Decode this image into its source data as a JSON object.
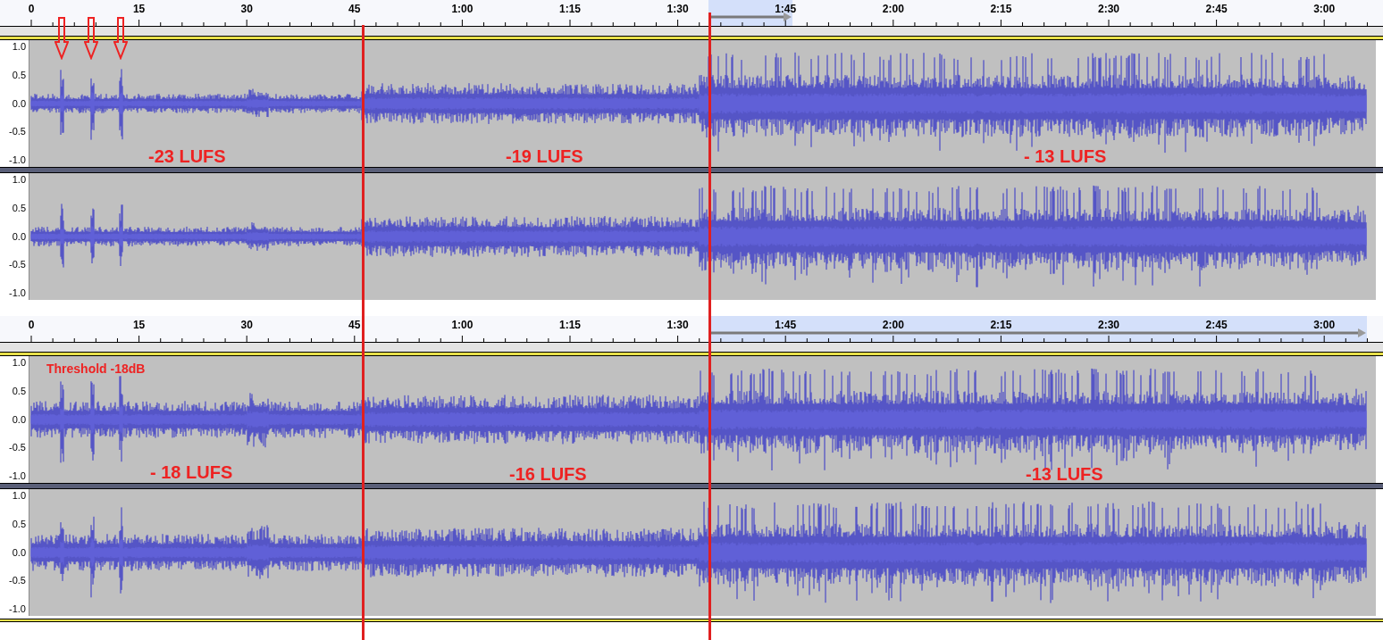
{
  "projects": [
    {
      "ruler": {
        "ticks": [
          "0",
          "15",
          "30",
          "45",
          "1:00",
          "1:15",
          "1:30",
          "1:45",
          "2:00",
          "2:15",
          "2:30",
          "2:45",
          "3:00"
        ]
      },
      "loudness_labels": [
        "-23 LUFS",
        "-19 LUFS",
        "- 13 LUFS"
      ],
      "channels": [
        {
          "axis_labels": [
            "1.0",
            "0.5",
            "0.0",
            "-0.5",
            "-1.0"
          ]
        },
        {
          "axis_labels": [
            "1.0",
            "0.5",
            "0.0",
            "-0.5",
            "-1.0"
          ]
        }
      ]
    },
    {
      "ruler": {
        "ticks": [
          "0",
          "15",
          "30",
          "45",
          "1:00",
          "1:15",
          "1:30",
          "1:45",
          "2:00",
          "2:15",
          "2:30",
          "2:45",
          "3:00"
        ]
      },
      "threshold_note": "Threshold -18dB",
      "loudness_labels": [
        "- 18 LUFS",
        "-16 LUFS",
        "-13 LUFS"
      ],
      "channels": [
        {
          "axis_labels": [
            "1.0",
            "0.5",
            "0.0",
            "-0.5",
            "-1.0"
          ]
        },
        {
          "axis_labels": [
            "1.0",
            "0.5",
            "0.0",
            "-0.5",
            "-1.0"
          ]
        }
      ]
    }
  ]
}
